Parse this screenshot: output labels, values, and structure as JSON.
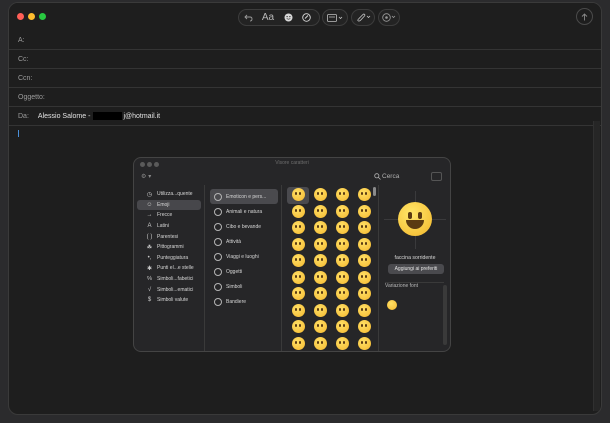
{
  "compose": {
    "fields": {
      "to_label": "A:",
      "cc_label": "Cc:",
      "bcc_label": "Ccn:",
      "subject_label": "Oggetto:",
      "from_label": "Da:",
      "from_name": "Alessio Salome -",
      "from_email_suffix": "j@hotmail.it"
    },
    "toolbar": {
      "font_label": "Aa"
    }
  },
  "character_viewer": {
    "title": "Visore caratteri",
    "search_placeholder": "Cerca",
    "categories": [
      {
        "icon": "clock-icon",
        "glyph": "◷",
        "label": "Utilizza...quente"
      },
      {
        "icon": "emoji-icon",
        "glyph": "☺",
        "label": "Emoji"
      },
      {
        "icon": "arrow-icon",
        "glyph": "→",
        "label": "Frecce"
      },
      {
        "icon": "latin-icon",
        "glyph": "A",
        "label": "Latini"
      },
      {
        "icon": "parentheses-icon",
        "glyph": "( )",
        "label": "Parentesi"
      },
      {
        "icon": "pictograph-icon",
        "glyph": "☘",
        "label": "Pittogrammi"
      },
      {
        "icon": "punctuation-icon",
        "glyph": "•,",
        "label": "Punteggiatura"
      },
      {
        "icon": "star-icon",
        "glyph": "✱",
        "label": "Punti el...e stelle"
      },
      {
        "icon": "letterlike-icon",
        "glyph": "℅",
        "label": "Simboli...fabetici"
      },
      {
        "icon": "math-icon",
        "glyph": "√",
        "label": "Simboli...ematici"
      },
      {
        "icon": "currency-icon",
        "glyph": "$",
        "label": "Simboli valute"
      }
    ],
    "active_category": "Emoji",
    "subcategories": [
      "Emoticon e pers...",
      "Animali e natura",
      "Cibo e bevande",
      "Attività",
      "Viaggi e luoghi",
      "Oggetti",
      "Simboli",
      "Bandiere"
    ],
    "active_subcategory": "Emoticon e pers...",
    "emoji_count": 40,
    "detail": {
      "name": "faccina sorridente",
      "add_favorite": "Aggiungi ai preferiti",
      "variation_title": "Variazione font"
    }
  }
}
